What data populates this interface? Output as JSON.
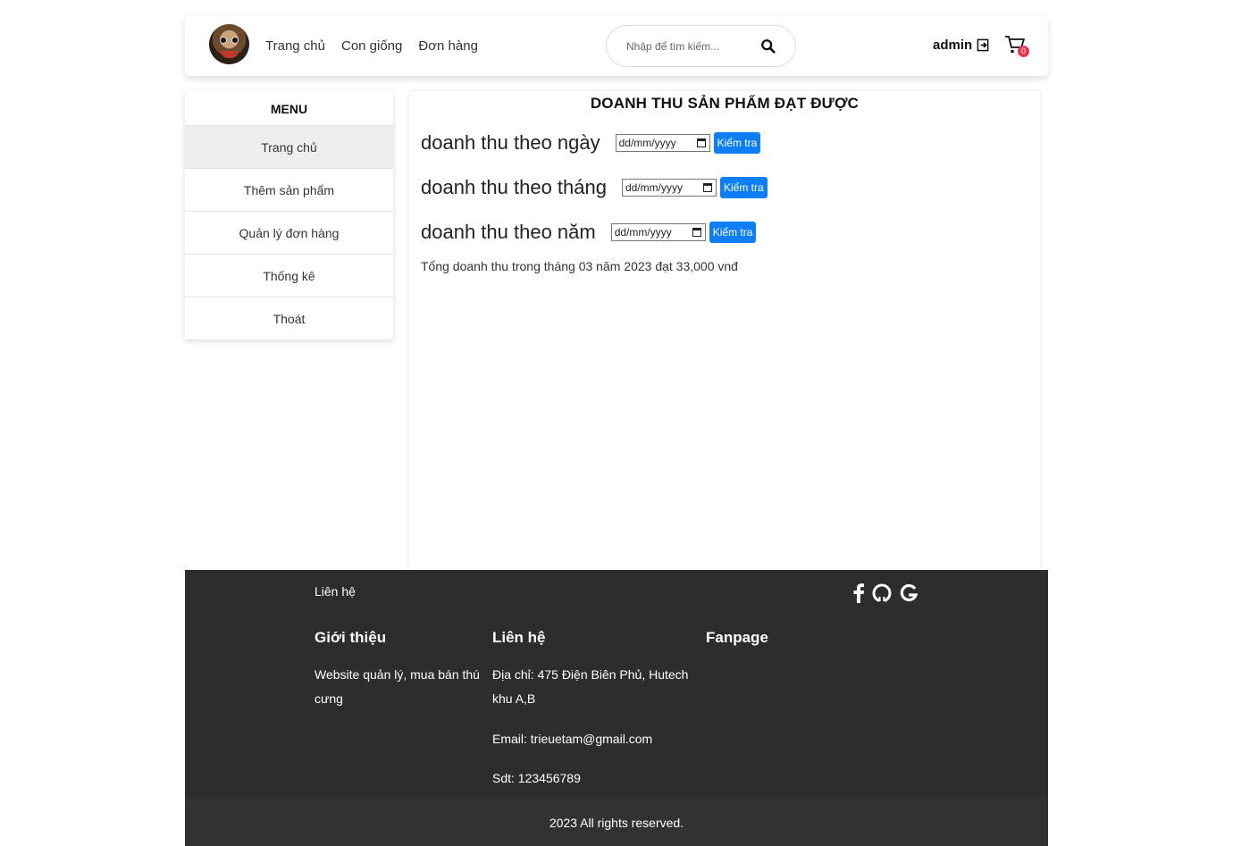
{
  "header": {
    "nav": [
      "Trang chủ",
      "Con giống",
      "Đơn hàng"
    ],
    "search_placeholder": "Nhập để tìm kiếm...",
    "user": "admin",
    "cart_count": "0"
  },
  "sidebar": {
    "title": "MENU",
    "items": [
      "Trang chủ",
      "Thêm sản phẩm",
      "Quản lý đơn hàng",
      "Thống kê",
      "Thoát"
    ]
  },
  "main": {
    "title": "DOANH THU SẢN PHẨM ĐẠT ĐƯỢC",
    "rows": [
      {
        "label": "doanh thu theo ngày",
        "date_placeholder": "dd/mm/yyyy",
        "button": "Kiểm tra"
      },
      {
        "label": "doanh thu theo tháng",
        "date_placeholder": "dd/mm/yyyy",
        "button": "Kiểm tra"
      },
      {
        "label": "doanh thu theo năm",
        "date_placeholder": "dd/mm/yyyy",
        "button": "Kiểm tra"
      }
    ],
    "result": "Tổng doanh thu trong tháng 03 năm 2023 đạt 33,000 vnđ"
  },
  "footer": {
    "contact_link": "Liên hệ",
    "about_heading": "Giới thiệu",
    "about_text": "Website quản lý, mua bán thú cưng",
    "contact_heading": "Liên hệ",
    "address": "Địa chỉ: 475 Điện Biên Phủ, Hutech khu A,B",
    "email": "Email: trieuetam@gmail.com",
    "phone": "Sdt: 123456789",
    "fanpage_heading": "Fanpage",
    "copyright": "2023 All rights reserved."
  },
  "colors": {
    "button": "#0d7ef5",
    "footer_bg": "#2d2d2d",
    "badge": "#e8354a"
  }
}
